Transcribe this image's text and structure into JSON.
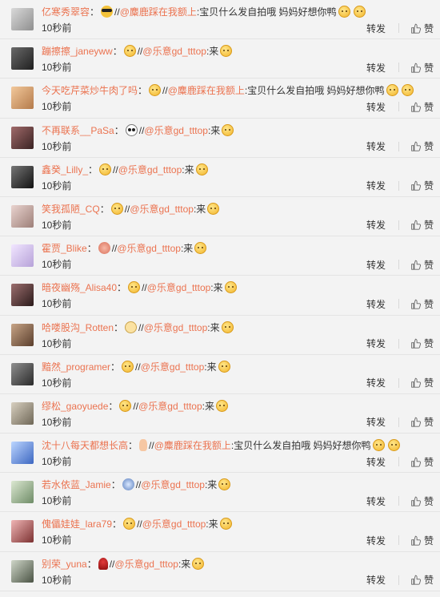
{
  "actions": {
    "repost": "转发",
    "like": "赞"
  },
  "comments": [
    {
      "user": "亿寒秀翠容",
      "emoji": "sunglasses-emoji",
      "repost_prefix": "//",
      "mention": "@麋鹿踩在我额上",
      "text": ":宝贝什么发自拍哦 妈妈好想你鸭",
      "trail_emoji": [
        "smile-emoji",
        "smile-emoji"
      ],
      "time": "10秒前"
    },
    {
      "user": "蹦擦擦_janeyww",
      "emoji": "blush-emoji",
      "repost_prefix": "//",
      "mention": "@乐意gd_tttop",
      "text": ":来",
      "trail_emoji": [
        "smile-emoji"
      ],
      "time": "10秒前"
    },
    {
      "user": "今天吃芹菜炒牛肉了吗",
      "emoji": "tongue-emoji",
      "repost_prefix": "//",
      "mention": "@麋鹿踩在我额上",
      "text": ":宝贝什么发自拍哦 妈妈好想你鸭",
      "trail_emoji": [
        "smile-emoji",
        "smile-emoji"
      ],
      "time": "10秒前"
    },
    {
      "user": "不再联系__PaSa",
      "emoji": "panda-emoji",
      "repost_prefix": "//",
      "mention": "@乐意gd_tttop",
      "text": ":来",
      "trail_emoji": [
        "smile-emoji"
      ],
      "time": "10秒前"
    },
    {
      "user": "鑫癸_Lilly_",
      "emoji": "shy-emoji",
      "repost_prefix": "//",
      "mention": "@乐意gd_tttop",
      "text": ":来",
      "trail_emoji": [
        "smile-emoji"
      ],
      "time": "10秒前"
    },
    {
      "user": "笑我孤陋_CQ",
      "emoji": "blush-emoji",
      "repost_prefix": "//",
      "mention": "@乐意gd_tttop",
      "text": ":来",
      "trail_emoji": [
        "smile-emoji"
      ],
      "time": "10秒前"
    },
    {
      "user": "霍贾_Blike",
      "emoji": "pink-face-emoji",
      "repost_prefix": "//",
      "mention": "@乐意gd_tttop",
      "text": ":来",
      "trail_emoji": [
        "smile-emoji"
      ],
      "time": "10秒前"
    },
    {
      "user": "暗夜幽殇_Alisa40",
      "emoji": "grin-emoji",
      "repost_prefix": "//",
      "mention": "@乐意gd_tttop",
      "text": ":来",
      "trail_emoji": [
        "smile-emoji"
      ],
      "time": "10秒前"
    },
    {
      "user": "哈喽股沟_Rotten",
      "emoji": "cat-emoji",
      "repost_prefix": "//",
      "mention": "@乐意gd_tttop",
      "text": ":来",
      "trail_emoji": [
        "smile-emoji"
      ],
      "time": "10秒前"
    },
    {
      "user": "黯然_programer",
      "emoji": "smile-emoji",
      "repost_prefix": "//",
      "mention": "@乐意gd_tttop",
      "text": ":来",
      "trail_emoji": [
        "smile-emoji"
      ],
      "time": "10秒前"
    },
    {
      "user": "缪松_gaoyuede",
      "emoji": "sleepy-emoji",
      "repost_prefix": "//",
      "mention": "@乐意gd_tttop",
      "text": ":来",
      "trail_emoji": [
        "smile-emoji"
      ],
      "time": "10秒前"
    },
    {
      "user": "沈十八每天都想长高",
      "emoji": "hand-emoji",
      "repost_prefix": "//",
      "mention": "@麋鹿踩在我额上",
      "text": ":宝贝什么发自拍哦 妈妈好想你鸭",
      "trail_emoji": [
        "smile-emoji",
        "smile-emoji"
      ],
      "time": "10秒前"
    },
    {
      "user": "若水依蓝_Jamie",
      "emoji": "blue-face-emoji",
      "repost_prefix": "//",
      "mention": "@乐意gd_tttop",
      "text": ":来",
      "trail_emoji": [
        "smile-emoji"
      ],
      "time": "10秒前"
    },
    {
      "user": "傀儡娃娃_lara79",
      "emoji": "shy-emoji",
      "repost_prefix": "//",
      "mention": "@乐意gd_tttop",
      "text": ":来",
      "trail_emoji": [
        "smile-emoji"
      ],
      "time": "10秒前"
    },
    {
      "user": "别荣_yuna",
      "emoji": "rose-emoji",
      "repost_prefix": "//",
      "mention": "@乐意gd_tttop",
      "text": ":来",
      "trail_emoji": [
        "smile-emoji"
      ],
      "time": "10秒前"
    }
  ]
}
